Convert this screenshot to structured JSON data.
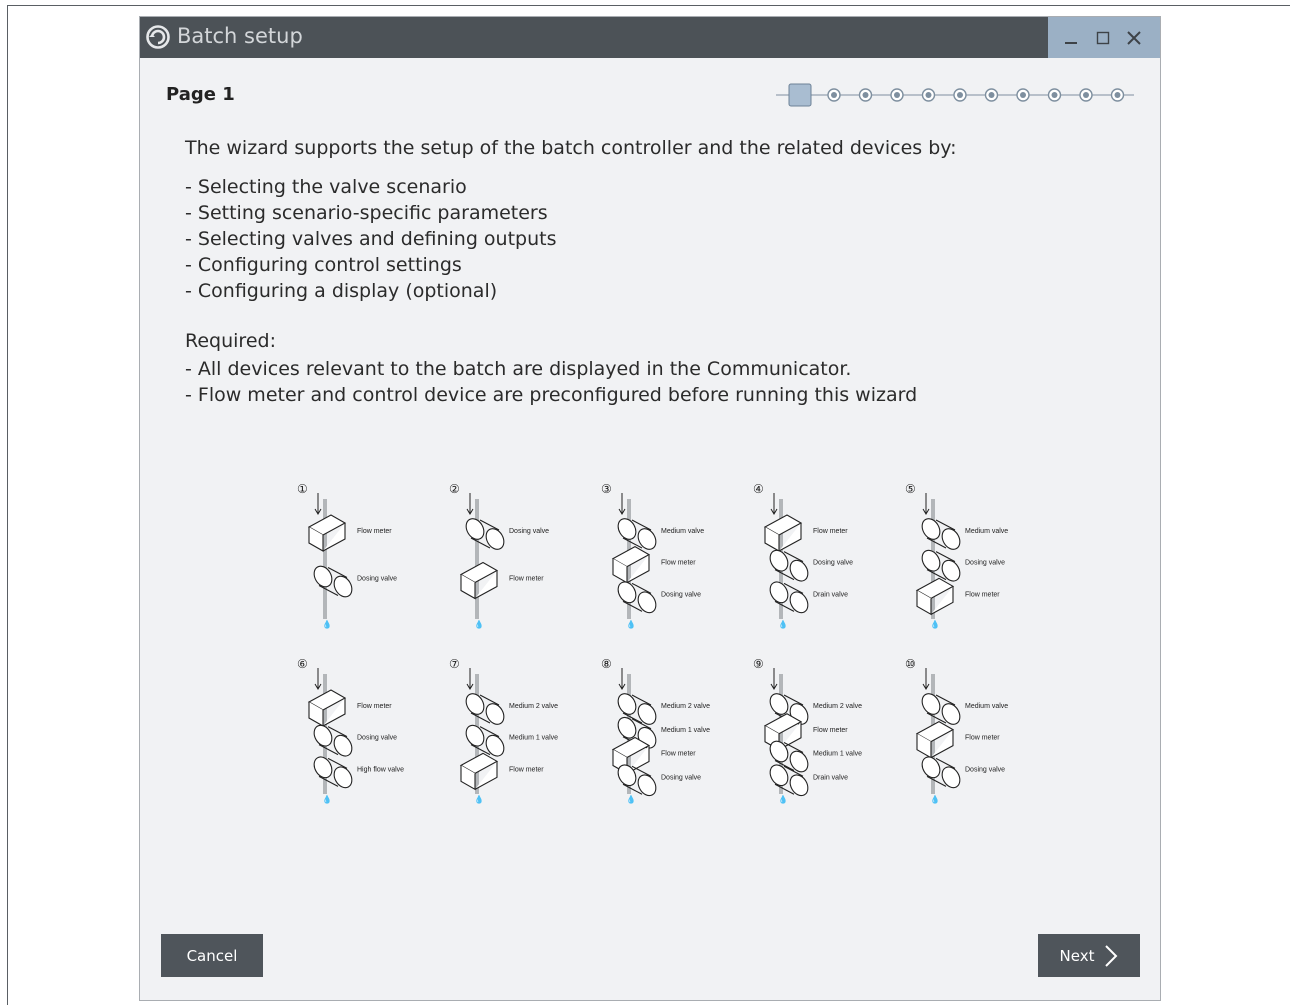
{
  "window": {
    "title": "Batch setup"
  },
  "page": {
    "label": "Page 1",
    "current_step": 1,
    "total_steps": 11
  },
  "content": {
    "intro": "The wizard supports the setup of the batch controller and the related devices by:",
    "bullets": [
      "- Selecting the valve scenario",
      "- Setting scenario-specific parameters",
      "- Selecting valves and defining outputs",
      "- Configuring control settings",
      "- Configuring a display (optional)"
    ],
    "required_label": "Required:",
    "required": [
      "- All devices relevant to the batch are displayed in the Communicator.",
      "- Flow meter and control device are preconfigured before running this wizard"
    ]
  },
  "scenarios": [
    {
      "number": "①",
      "labels": [
        "Flow meter",
        "Dosing valve"
      ]
    },
    {
      "number": "②",
      "labels": [
        "Dosing valve",
        "Flow meter"
      ]
    },
    {
      "number": "③",
      "labels": [
        "Medium valve",
        "Flow meter",
        "Dosing valve"
      ]
    },
    {
      "number": "④",
      "labels": [
        "Flow meter",
        "Dosing valve",
        "Drain valve"
      ]
    },
    {
      "number": "⑤",
      "labels": [
        "Medium valve",
        "Dosing valve",
        "Flow meter"
      ]
    },
    {
      "number": "⑥",
      "labels": [
        "Flow meter",
        "Dosing valve",
        "High flow valve"
      ]
    },
    {
      "number": "⑦",
      "labels": [
        "Medium 2 valve",
        "Medium 1 valve",
        "Flow meter"
      ]
    },
    {
      "number": "⑧",
      "labels": [
        "Medium 2 valve",
        "Medium 1 valve",
        "Flow meter",
        "Dosing valve"
      ]
    },
    {
      "number": "⑨",
      "labels": [
        "Medium 2 valve",
        "Flow meter",
        "Medium 1 valve",
        "Drain valve"
      ]
    },
    {
      "number": "⑩",
      "labels": [
        "Medium valve",
        "Flow meter",
        "Dosing valve"
      ]
    }
  ],
  "buttons": {
    "cancel": "Cancel",
    "next": "Next"
  },
  "colors": {
    "titlebar": "#4c5257",
    "title_accent": "#9bb0c5",
    "button": "#4f555b",
    "stepper_active": "#a9bdd1",
    "stepper_line": "#7e8f9f"
  },
  "icons": [
    "app-logo-icon",
    "minimize-icon",
    "maximize-icon",
    "close-icon",
    "chevron-right-icon"
  ]
}
